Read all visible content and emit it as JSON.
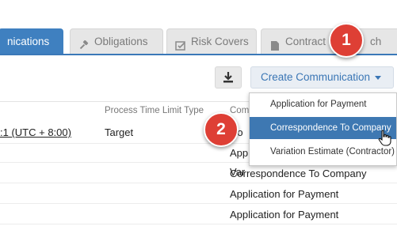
{
  "tabs": [
    {
      "label": "nications",
      "icon": "none",
      "active": true
    },
    {
      "label": "Obligations",
      "icon": "gavel-icon",
      "active": false
    },
    {
      "label": "Risk Covers",
      "icon": "edit-check-icon",
      "active": false
    },
    {
      "label": "Contract",
      "icon": "document-icon",
      "active": false
    },
    {
      "label": "ch",
      "icon": "none",
      "active": false
    }
  ],
  "toolbar": {
    "download_icon": "download-icon",
    "create_label": "Create Communication"
  },
  "table": {
    "headers": [
      "Process Time Limit Type",
      "Com"
    ],
    "rows": [
      {
        "date": ":1 (UTC + 8:00)",
        "type": "Target",
        "communication": "Co"
      },
      {
        "date": "",
        "type": "",
        "communication": "App"
      },
      {
        "date": "",
        "type": "",
        "communication": "Var"
      },
      {
        "date": "",
        "type": "",
        "communication": "Correspondence To Company"
      },
      {
        "date": "",
        "type": "",
        "communication": "Application for Payment"
      },
      {
        "date": "",
        "type": "",
        "communication": "Application for Payment"
      }
    ]
  },
  "dropdown": {
    "items": [
      {
        "label": "Application for Payment",
        "highlighted": false
      },
      {
        "label": "Correspondence To Company",
        "highlighted": true
      },
      {
        "label": "Variation Estimate (Contractor)",
        "highlighted": false
      }
    ]
  },
  "badges": [
    {
      "number": "1"
    },
    {
      "number": "2"
    }
  ],
  "colors": {
    "accent": "#3f80c0",
    "badge": "#de3f35",
    "highlight": "#3e78b2"
  }
}
